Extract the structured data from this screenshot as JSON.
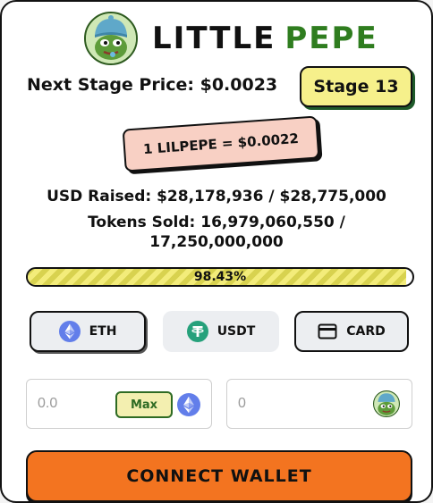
{
  "brand": {
    "title_part1": "LITTLE",
    "title_part2": "PEPE",
    "accent_color": "#2f7d1f",
    "logo_icon": "pepe-logo-icon"
  },
  "presale": {
    "next_stage_price": "Next Stage Price: $0.0023",
    "stage_label": "Stage 13",
    "rate": "1 LILPEPE = $0.0022",
    "usd_raised": "USD Raised: $28,178,936 / $28,775,000",
    "tokens_sold_line1": "Tokens Sold: 16,979,060,550 /",
    "tokens_sold_line2": "17,250,000,000",
    "progress_fraction": 0.9843,
    "progress_text": "98.43%"
  },
  "payment_tabs": [
    {
      "label": "ETH",
      "icon": "ethereum-icon",
      "selected": true
    },
    {
      "label": "USDT",
      "icon": "tether-icon",
      "selected": false
    },
    {
      "label": "CARD",
      "icon": "credit-card-icon",
      "selected": false
    }
  ],
  "pay_input": {
    "placeholder": "0.0",
    "max_label": "Max",
    "currency_icon": "ethereum-icon"
  },
  "receive_input": {
    "placeholder": "0",
    "currency_icon": "pepe-token-icon"
  },
  "connect_label": "CONNECT WALLET",
  "colors": {
    "connect_button": "#f37420",
    "stage_badge": "#f6f08b",
    "rate_badge": "#f8d0c4",
    "progress_fill": "#f3ec7a"
  }
}
